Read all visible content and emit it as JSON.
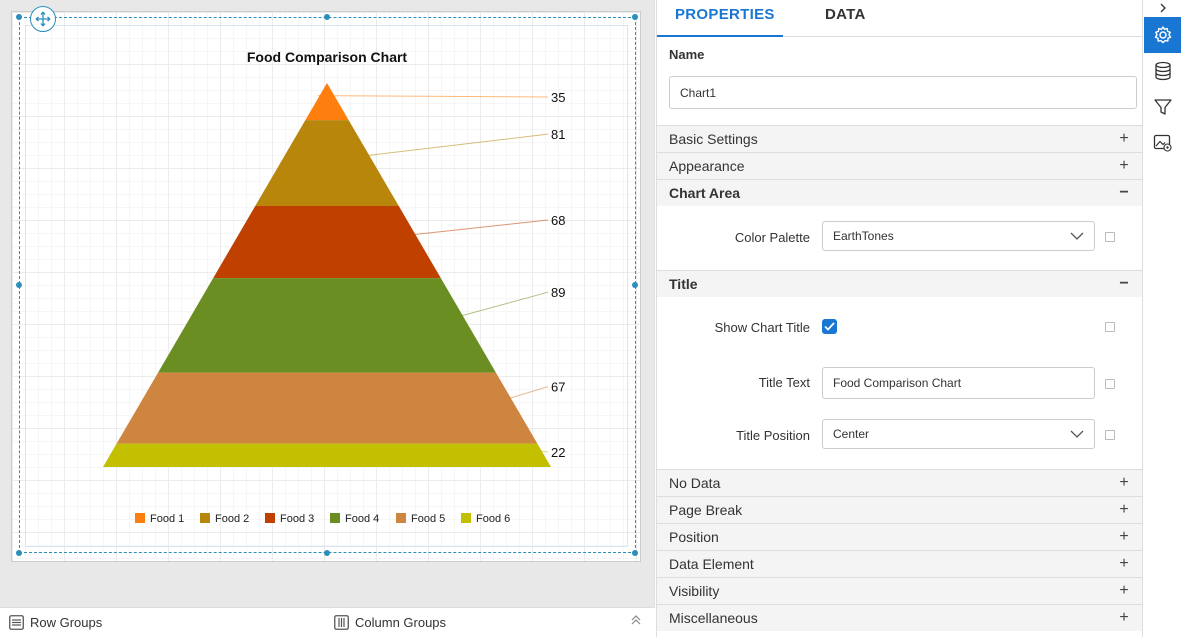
{
  "chart_data": {
    "type": "pyramid",
    "title": "Food Comparison Chart",
    "categories": [
      "Food 1",
      "Food 2",
      "Food 3",
      "Food 4",
      "Food 5",
      "Food 6"
    ],
    "values": [
      35,
      81,
      68,
      89,
      67,
      22
    ],
    "colors": [
      "#ff7f0e",
      "#b8860b",
      "#c04000",
      "#6b8e23",
      "#cd853f",
      "#c2c000"
    ],
    "palette": "EarthTones",
    "legend_position": "bottom"
  },
  "groups_bar": {
    "row_groups": "Row Groups",
    "column_groups": "Column Groups"
  },
  "panel": {
    "tabs": [
      "PROPERTIES",
      "DATA"
    ],
    "name_label": "Name",
    "name_value": "Chart1",
    "sections": {
      "basic": "Basic Settings",
      "appearance": "Appearance",
      "chart_area": "Chart Area",
      "title": "Title",
      "no_data": "No Data",
      "page_break": "Page Break",
      "position": "Position",
      "data_element": "Data Element",
      "visibility": "Visibility",
      "misc": "Miscellaneous"
    },
    "chart_area": {
      "color_palette_label": "Color Palette",
      "color_palette_value": "EarthTones"
    },
    "title_section": {
      "show_label": "Show Chart Title",
      "show_checked": true,
      "text_label": "Title Text",
      "text_value": "Food Comparison Chart",
      "position_label": "Title Position",
      "position_value": "Center"
    },
    "signs": {
      "plus": "+",
      "minus": "−"
    }
  }
}
